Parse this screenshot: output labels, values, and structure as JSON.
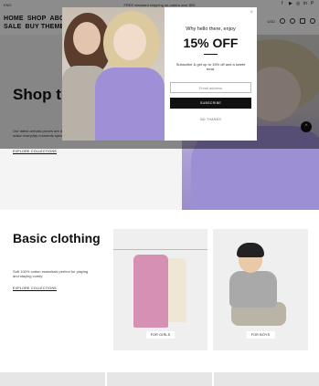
{
  "announcement": {
    "language": "ENG",
    "message": "FREE standard shipping on orders over $99"
  },
  "header": {
    "nav": [
      "HOME",
      "SHOP",
      "ABOUT",
      "SALE",
      "BUY THEME"
    ],
    "currency": "USD"
  },
  "hero": {
    "title": "Shop the new collection",
    "description": "Our latest arrivals pieces are designed to make everyday moments special.",
    "link": "EXPLORE COLLECTIONS"
  },
  "basic": {
    "title": "Basic clothing",
    "description": "Soft 100% cotton essentials perfect for playing and staying comfy.",
    "link": "EXPLORE COLLECTIONS",
    "card1_tag": "FOR GIRLS",
    "card2_tag": "FOR BOYS"
  },
  "popup": {
    "hello": "Why hello there, enjoy",
    "headline": "15% OFF",
    "subtext": "Subscribe & get up to 15% off and a sweet treat.",
    "email_placeholder": "Email address",
    "button": "SUBSCRIBE",
    "no_thanks": "NO THANKS",
    "close": "×"
  }
}
